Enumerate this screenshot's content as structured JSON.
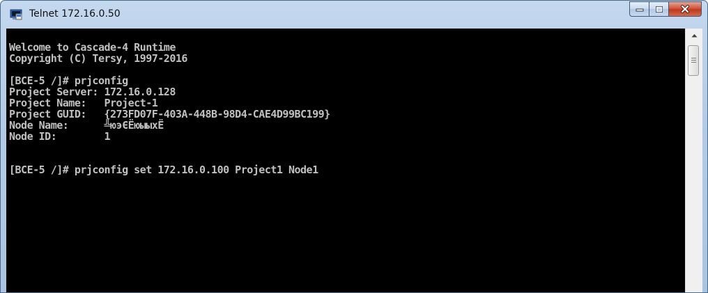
{
  "window": {
    "title": "Telnet 172.16.0.50"
  },
  "colors": {
    "console_bg": "#000000",
    "console_fg": "#c0c0c0",
    "close_button": "#c8432a"
  },
  "console": {
    "lines": [
      "Welcome to Cascade-4 Runtime",
      "Copyright (C) Tersy, 1997-2016",
      "",
      "[BCE-5 /]# prjconfig",
      "Project Server: 172.16.0.128",
      "Project Name:   Project-1",
      "Project GUID:   {273FD07F-403A-448B-98D4-CAE4D99BC199}",
      "Node Name:      ╩юэЄЁюыыхЁ",
      "Node ID:        1",
      "",
      "[BCE-5 /]# prjconfig set 172.16.0.100 Project1 Node1"
    ]
  },
  "icons": {
    "app": "telnet-terminal-icon",
    "minimize": "minimize-icon",
    "maximize": "maximize-icon",
    "close": "close-icon",
    "scroll_up": "scroll-up-arrow-icon"
  }
}
